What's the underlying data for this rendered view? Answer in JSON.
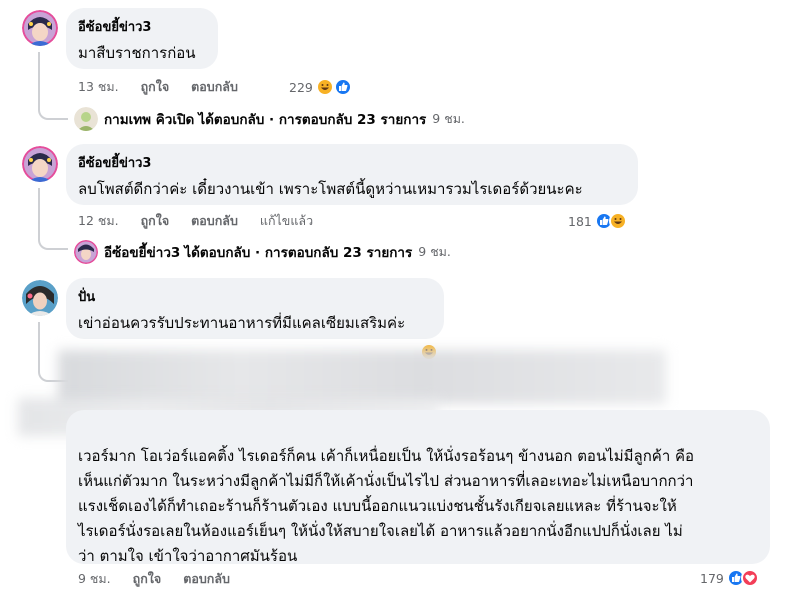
{
  "comments": [
    {
      "author": "อีซ้อขยี้ข่าว3",
      "text": "มาสืบราชการก่อน",
      "time": "13 ชม.",
      "like_label": "ถูกใจ",
      "reply_label": "ตอบกลับ",
      "reaction_count": "229",
      "reactions": [
        "haha",
        "like"
      ]
    },
    {
      "author": "อีซ้อขยี้ข่าว3",
      "text": "ลบโพสต์ดีกว่าค่ะ เดี๋ยวงานเข้า เพราะโพสต์นี้ดูหว่านเหมารวมไรเดอร์ด้วยนะคะ",
      "time": "12 ชม.",
      "like_label": "ถูกใจ",
      "reply_label": "ตอบกลับ",
      "edited_label": "แก้ไขแล้ว",
      "reaction_count": "181",
      "reactions": [
        "like",
        "haha"
      ]
    },
    {
      "author": "ปั่น",
      "text": "เข่าอ่อนควรรับประทานอาหารที่มีแคลเซียมเสริมค่ะ"
    },
    {
      "text_lines": [
        "เวอร์มาก โอเว่อร์แอคติ้ง ไรเดอร์ก็คน เค้าก็เหนื่อยเป็น ให้นั่งรอร้อนๆ ข้างนอก ตอนไม่มีลูกค้า คือ",
        "เห็นแก่ตัวมาก ในระหว่างมีลูกค้าไม่มีก็ให้เค้านั่งเป็นไรไป ส่วนอาหารที่เลอะเทอะไม่เหนือบากกว่า",
        "แรงเช็ดเองได้ก็ทำเถอะร้านก็ร้านตัวเอง แบบนี้ออกแนวแบ่งชนชั้นรังเกียจเลยแหละ ที่ร้านจะให้",
        "ไรเดอร์นั่งรอเลยในห้องแอร์เย็นๆ ให้นั่งให้สบายใจเลยได้ อาหารแล้วอยากนั่งอีกแปปก็นั่งเลย ไม่",
        "ว่า ตามใจ เข้าใจว่าอากาศมันร้อน"
      ],
      "time": "9 ชม.",
      "like_label": "ถูกใจ",
      "reply_label": "ตอบกลับ",
      "reaction_count": "179",
      "reactions": [
        "like",
        "love"
      ]
    }
  ],
  "reply_summaries": [
    {
      "name": "กามเทพ คิวเปิด",
      "tail": "ได้ตอบกลับ · การตอบกลับ 23 รายการ",
      "time": "9 ชม."
    },
    {
      "name": "อีซ้อขยี้ข่าว3",
      "tail": "ได้ตอบกลับ · การตอบกลับ 23 รายการ",
      "time": "9 ชม."
    }
  ],
  "colors": {
    "bubble": "#f0f2f5",
    "meta": "#65676b",
    "like_blue": "#1877f2",
    "haha_yellow": "#f7b125",
    "love_red": "#f33e58",
    "thread_line": "#ced0d4"
  }
}
